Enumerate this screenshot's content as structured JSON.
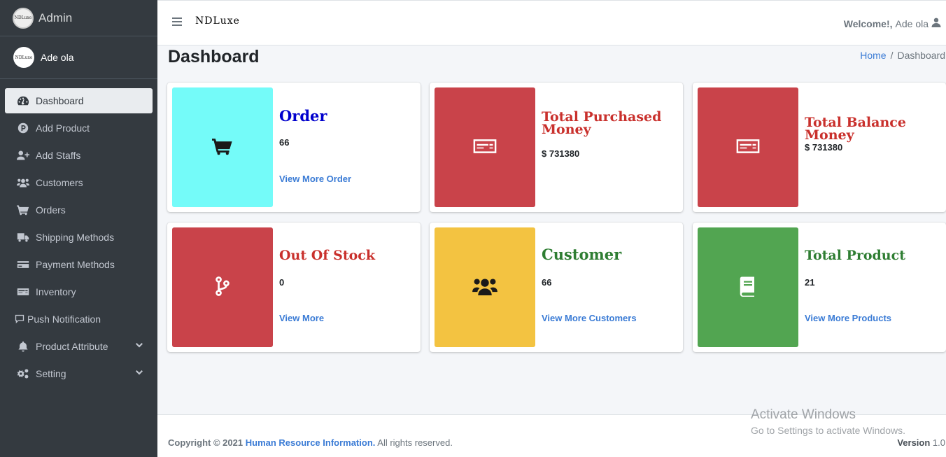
{
  "brand": {
    "name": "Admin",
    "logo_text": "NDLuxe"
  },
  "user": {
    "name": "Ade ola",
    "avatar_text": "NDLuxe"
  },
  "sidebar": {
    "items": [
      {
        "label": "Dashboard",
        "icon": "tachometer-icon"
      },
      {
        "label": "Add Product",
        "icon": "product-p-icon"
      },
      {
        "label": "Add Staffs",
        "icon": "user-plus-icon"
      },
      {
        "label": "Customers",
        "icon": "users-icon"
      },
      {
        "label": "Orders",
        "icon": "cart-icon"
      },
      {
        "label": "Shipping Methods",
        "icon": "truck-icon"
      },
      {
        "label": "Payment Methods",
        "icon": "credit-card-icon"
      },
      {
        "label": "Inventory",
        "icon": "money-check-icon"
      },
      {
        "label": "Push Notification",
        "icon": "comment-icon"
      },
      {
        "label": "Product Attribute",
        "icon": "bell-icon"
      },
      {
        "label": "Setting",
        "icon": "cogs-icon"
      }
    ]
  },
  "header": {
    "logo_text": "NDLuxe",
    "welcome_label": "Welcome!,",
    "welcome_name": "Ade ola"
  },
  "page": {
    "title": "Dashboard"
  },
  "breadcrumb": {
    "home": "Home",
    "separator": "/",
    "current": "Dashboard"
  },
  "cards": [
    {
      "title": "Order",
      "value": "66",
      "link": "View More Order",
      "tile_color": "#74fbf9",
      "title_color": "#0000cd",
      "icon": "cart-icon"
    },
    {
      "title": "Total Purchased Money",
      "value": "$ 731380",
      "link": "",
      "tile_color": "#c9434a",
      "title_color": "#c9302c",
      "icon": "money-check-icon"
    },
    {
      "title": "Total Balance Money",
      "value": "$ 731380",
      "link": "",
      "tile_color": "#c9434a",
      "title_color": "#c9302c",
      "icon": "money-check-icon"
    },
    {
      "title": "Out Of Stock",
      "value": "0",
      "link": "View More",
      "tile_color": "#c9434a",
      "title_color": "#c9302c",
      "icon": "code-branch-icon"
    },
    {
      "title": "Customer",
      "value": "66",
      "link": "View More Customers",
      "tile_color": "#f3c341",
      "title_color": "#2e7d32",
      "icon": "users-icon"
    },
    {
      "title": "Total Product",
      "value": "21",
      "link": "View More Products",
      "tile_color": "#52a551",
      "title_color": "#2e7d32",
      "icon": "book-icon"
    }
  ],
  "footer": {
    "copyright": "Copyright © 2021",
    "company": "Human Resource Information.",
    "rights": "All rights reserved.",
    "version_label": "Version",
    "version": "1.0"
  },
  "watermark": {
    "line1": "Activate Windows",
    "line2": "Go to Settings to activate Windows."
  }
}
